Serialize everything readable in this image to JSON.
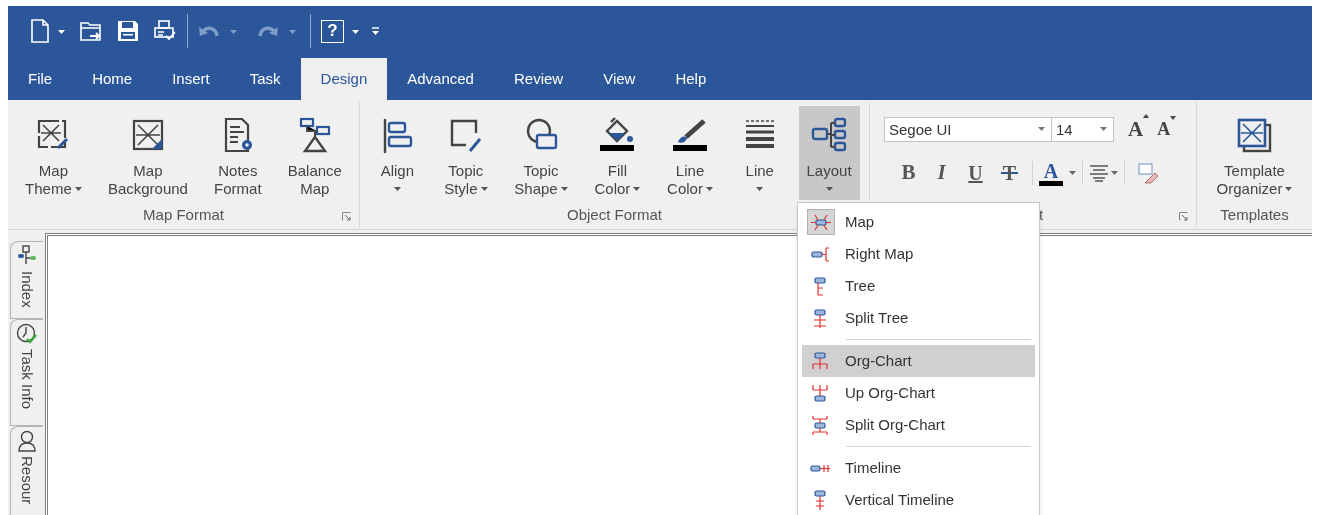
{
  "quick_access": {
    "undo_enabled": false,
    "redo_enabled": false,
    "help_label": "?"
  },
  "tabs": [
    {
      "label": "File",
      "selected": false
    },
    {
      "label": "Home",
      "selected": false
    },
    {
      "label": "Insert",
      "selected": false
    },
    {
      "label": "Task",
      "selected": false
    },
    {
      "label": "Design",
      "selected": true
    },
    {
      "label": "Advanced",
      "selected": false
    },
    {
      "label": "Review",
      "selected": false
    },
    {
      "label": "View",
      "selected": false
    },
    {
      "label": "Help",
      "selected": false
    }
  ],
  "ribbon": {
    "groups": [
      {
        "kind": "buttons",
        "label": "Map Format",
        "launcher": true,
        "buttons": [
          {
            "lines": [
              "Map",
              "Theme"
            ],
            "dropdown": true,
            "pressed": false
          },
          {
            "lines": [
              "Map",
              "Background"
            ],
            "dropdown": false,
            "pressed": false
          },
          {
            "lines": [
              "Notes",
              "Format"
            ],
            "dropdown": false,
            "pressed": false
          },
          {
            "lines": [
              "Balance",
              "Map"
            ],
            "dropdown": false,
            "pressed": false
          }
        ]
      },
      {
        "kind": "buttons",
        "label": "Object Format",
        "launcher": false,
        "buttons": [
          {
            "lines": [
              "Align"
            ],
            "dropdown": true,
            "pressed": false
          },
          {
            "lines": [
              "Topic",
              "Style"
            ],
            "dropdown": true,
            "pressed": false
          },
          {
            "lines": [
              "Topic",
              "Shape"
            ],
            "dropdown": true,
            "pressed": false
          },
          {
            "lines": [
              "Fill",
              "Color"
            ],
            "dropdown": true,
            "pressed": false
          },
          {
            "lines": [
              "Line",
              "Color"
            ],
            "dropdown": true,
            "pressed": false
          },
          {
            "lines": [
              "Line"
            ],
            "dropdown": true,
            "pressed": false
          },
          {
            "lines": [
              "Layout"
            ],
            "dropdown": true,
            "pressed": true
          }
        ]
      },
      {
        "kind": "font",
        "label": "t",
        "launcher": true,
        "font_name": "Segoe UI",
        "font_size": "14",
        "size_buttons": [
          {
            "label": "A",
            "kind": "grow"
          },
          {
            "label": "A",
            "kind": "shrink"
          }
        ],
        "format_buttons": [
          {
            "label": "B",
            "kind": "bold"
          },
          {
            "label": "I",
            "kind": "italic"
          },
          {
            "label": "U",
            "kind": "underline"
          },
          {
            "label": "T",
            "kind": "strike"
          },
          {
            "label": "A",
            "kind": "font-color"
          }
        ]
      },
      {
        "kind": "buttons",
        "label": "Templates",
        "launcher": false,
        "buttons": [
          {
            "lines": [
              "Template",
              "Organizer"
            ],
            "dropdown": true,
            "pressed": false
          }
        ]
      }
    ]
  },
  "layout_menu": {
    "groups": [
      [
        {
          "label": "Map",
          "checked": true,
          "selected": false
        },
        {
          "label": "Right Map",
          "checked": false,
          "selected": false
        },
        {
          "label": "Tree",
          "checked": false,
          "selected": false
        },
        {
          "label": "Split Tree",
          "checked": false,
          "selected": false
        }
      ],
      [
        {
          "label": "Org-Chart",
          "checked": false,
          "selected": true
        },
        {
          "label": "Up Org-Chart",
          "checked": false,
          "selected": false
        },
        {
          "label": "Split Org-Chart",
          "checked": false,
          "selected": false
        }
      ],
      [
        {
          "label": "Timeline",
          "checked": false,
          "selected": false
        },
        {
          "label": "Vertical Timeline",
          "checked": false,
          "selected": false
        }
      ]
    ]
  },
  "side_tabs": [
    {
      "label": "Index"
    },
    {
      "label": "Task Info"
    },
    {
      "label": "Resour"
    }
  ]
}
